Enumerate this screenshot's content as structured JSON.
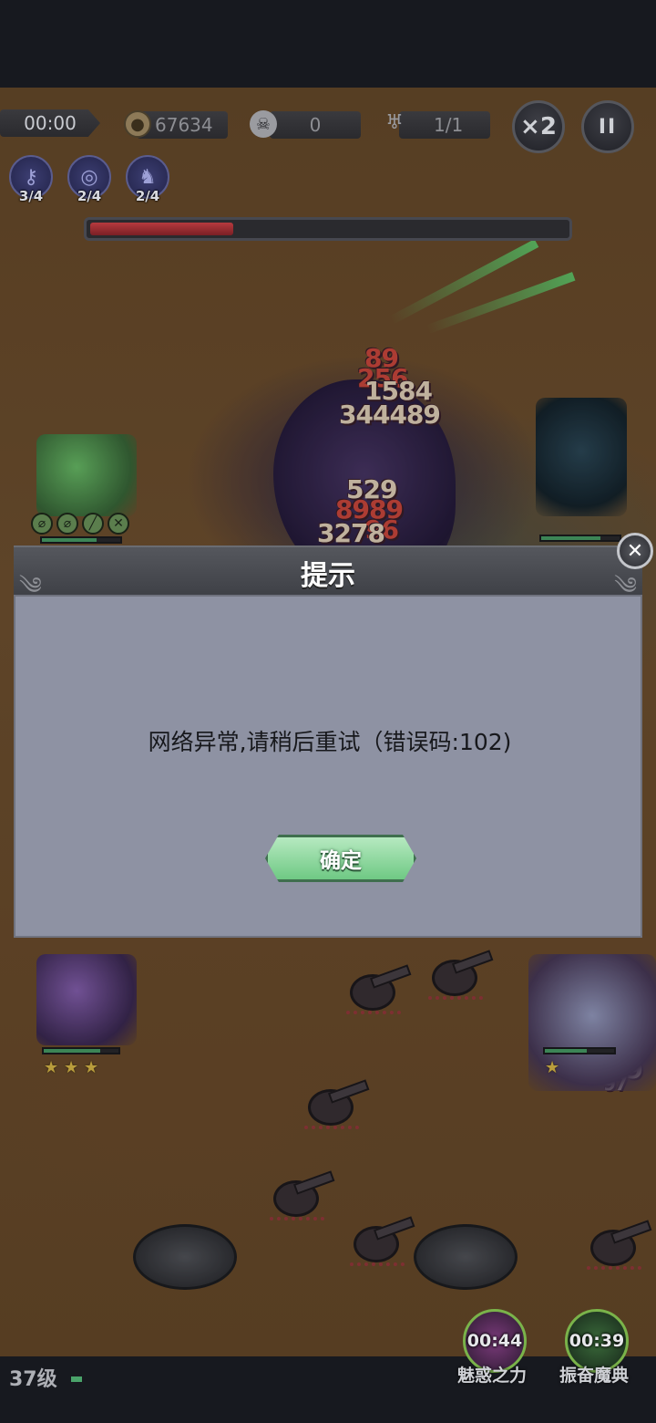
{
  "hud": {
    "timer": "00:00",
    "coins": "67634",
    "kills": "0",
    "wave": "1/1",
    "speed_label": "×2",
    "pause_label": "II"
  },
  "skill_slots": [
    {
      "icon": "key-icon",
      "count": "3/4"
    },
    {
      "icon": "target-icon",
      "count": "2/4"
    },
    {
      "icon": "wolf-icon",
      "count": "2/4"
    }
  ],
  "boss_hp_fraction": 0.3,
  "damage_numbers": [
    "89",
    "256",
    "1584",
    "344489",
    "529",
    "8989",
    "96",
    "3278",
    "89",
    "97"
  ],
  "dialog": {
    "title": "提示",
    "message": "网络异常,请稍后重试（错误码:102)",
    "confirm_label": "确定",
    "close_label": "✕"
  },
  "bottom": {
    "level": "37级",
    "skills": [
      {
        "timer": "00:44",
        "name": "魅惑之力"
      },
      {
        "timer": "00:39",
        "name": "振奋魔典"
      }
    ]
  },
  "colors": {
    "dialog_body": "#8e92a3",
    "dialog_header": "#4a4c52",
    "confirm_button": "#8fd9a0",
    "boss_hp": "#a83338"
  }
}
